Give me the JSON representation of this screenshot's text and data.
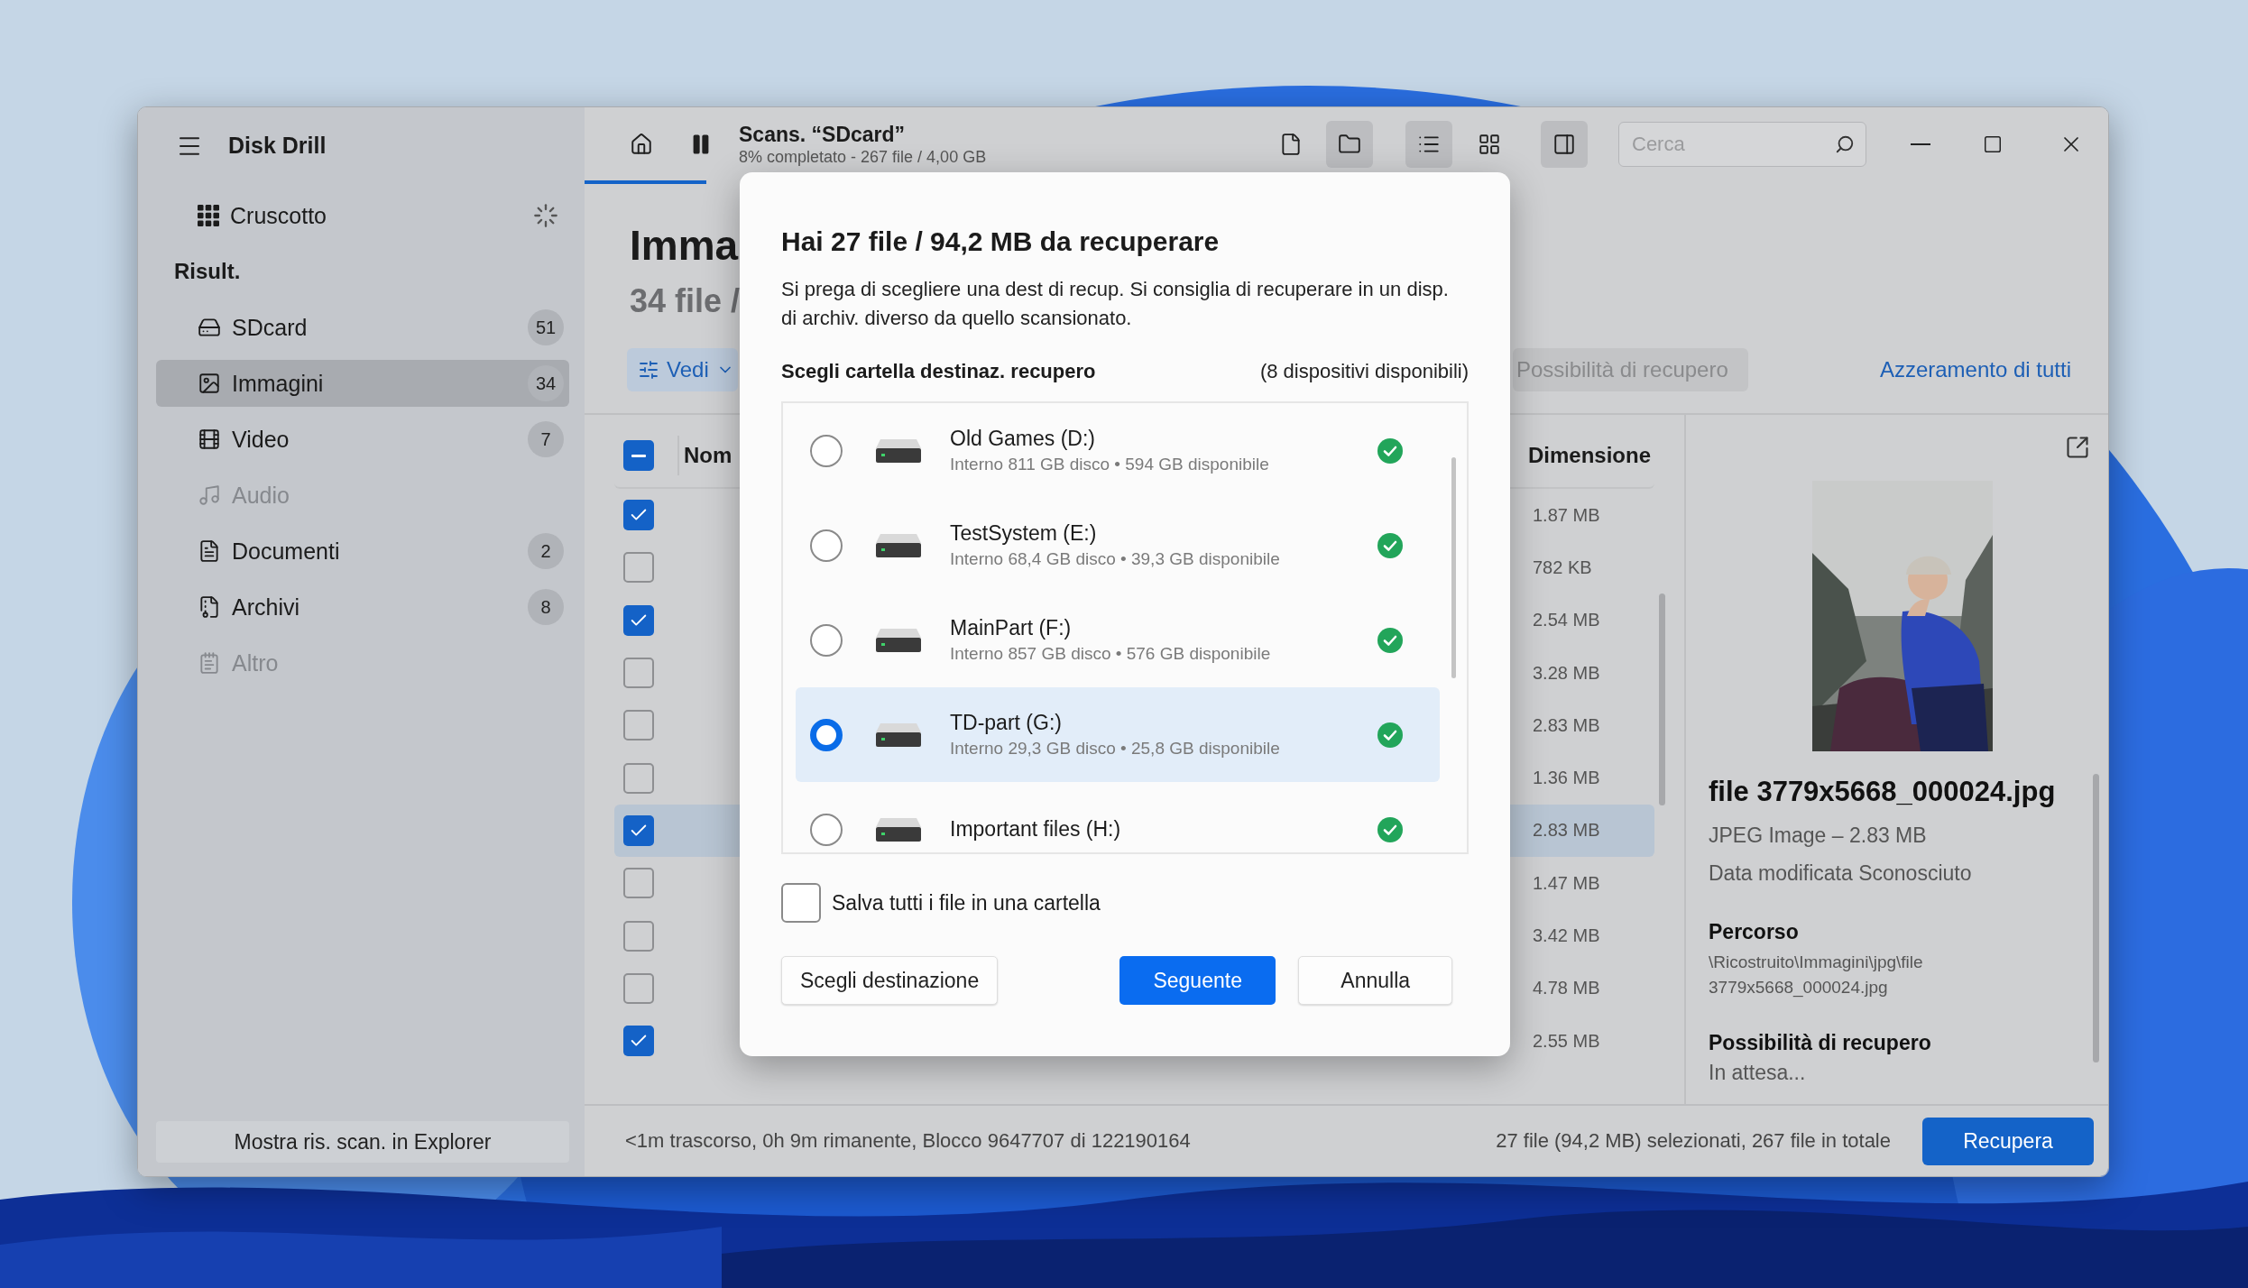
{
  "app": {
    "title": "Disk Drill"
  },
  "sidebar": {
    "dashboard": {
      "label": "Cruscotto",
      "busy": true
    },
    "results_heading": "Risult.",
    "categories": [
      {
        "label": "SDcard",
        "count": "51",
        "selected": false,
        "disabled": false
      },
      {
        "label": "Immagini",
        "count": "34",
        "selected": true,
        "disabled": false
      },
      {
        "label": "Video",
        "count": "7",
        "selected": false,
        "disabled": false
      },
      {
        "label": "Audio",
        "selected": false,
        "disabled": true
      },
      {
        "label": "Documenti",
        "count": "2",
        "selected": false,
        "disabled": false
      },
      {
        "label": "Archivi",
        "count": "8",
        "selected": false,
        "disabled": false
      },
      {
        "label": "Altro",
        "selected": false,
        "disabled": true
      }
    ],
    "explorer_button": "Mostra ris. scan. in Explorer"
  },
  "toolbar": {
    "scan_title": "Scans. “SDcard”",
    "scan_progress": "8% completato - 267 file / 4,00 GB",
    "progress": {
      "level": 0.08
    },
    "view_buttons": [
      {
        "kind": "file",
        "selected": false
      },
      {
        "kind": "folder",
        "selected": true
      },
      {
        "kind": "list",
        "selected": true
      },
      {
        "kind": "grid",
        "selected": false
      },
      {
        "kind": "panel",
        "selected": true
      }
    ],
    "search": {
      "placeholder": "Cerca"
    }
  },
  "content": {
    "heading": "Imma",
    "subheading": "34 file /",
    "view_button": "Vedi",
    "filter_chip": "Possibilità di recupero",
    "reset_link": "Azzeramento di tutti"
  },
  "table": {
    "select_all": {
      "indeterminate": true
    },
    "columns": [
      "Nom",
      "Dimensione"
    ],
    "rows": [
      {
        "checked": true,
        "selected": false,
        "size": "1.87 MB"
      },
      {
        "checked": false,
        "selected": false,
        "size": "782 KB"
      },
      {
        "checked": true,
        "selected": false,
        "size": "2.54 MB"
      },
      {
        "checked": false,
        "selected": false,
        "size": "3.28 MB"
      },
      {
        "checked": false,
        "selected": false,
        "size": "2.83 MB"
      },
      {
        "checked": false,
        "selected": false,
        "size": "1.36 MB"
      },
      {
        "checked": true,
        "selected": true,
        "size": "2.83 MB"
      },
      {
        "checked": false,
        "selected": false,
        "size": "1.47 MB"
      },
      {
        "checked": false,
        "selected": false,
        "size": "3.42 MB"
      },
      {
        "checked": false,
        "selected": false,
        "size": "4.78 MB"
      },
      {
        "checked": true,
        "selected": false,
        "size": "2.55 MB"
      }
    ]
  },
  "preview": {
    "kind": "picture",
    "filename": "file 3779x5668_000024.jpg",
    "type_size": "JPEG Image – 2.83 MB",
    "modified": "Data modificata Sconosciuto",
    "path_label": "Percorso",
    "path": "\\Ricostruito\\Immagini\\jpg\\file 3779x5668_000024.jpg",
    "recovery_label": "Possibilità di recupero",
    "recovery_value": "In attesa..."
  },
  "status_bar": {
    "progress_text": "<1m trascorso, 0h 9m rimanente, Blocco 9647707 di 122190164",
    "selection_text": "27 file (94,2 MB) selezionati, 267 file in totale",
    "recover_button": "Recupera"
  },
  "dialog": {
    "title": "Hai 27 file / 94,2 MB da recuperare",
    "description": "Si prega di scegliere una dest di recup. Si consiglia di recuperare in un disp. di archiv. diverso da quello scansionato.",
    "section_label": "Scegli cartella destinaz. recupero",
    "device_count": "(8 dispositivi disponibili)",
    "drives": [
      {
        "name": "Old Games (D:)",
        "detail": "Interno 811 GB disco • 594 GB disponibile",
        "selected": false
      },
      {
        "name": "TestSystem (E:)",
        "detail": "Interno 68,4 GB disco • 39,3 GB disponibile",
        "selected": false
      },
      {
        "name": "MainPart (F:)",
        "detail": "Interno 857 GB disco • 576 GB disponibile",
        "selected": false
      },
      {
        "name": "TD-part (G:)",
        "detail": "Interno 29,3 GB disco • 25,8 GB disponibile",
        "selected": true
      },
      {
        "name": "Important files (H:)",
        "selected": false
      }
    ],
    "save_all": {
      "label": "Salva tutti i file in una cartella",
      "checked": false
    },
    "buttons": [
      {
        "label": "Scegli destinazione",
        "kind": "secondary"
      },
      {
        "label": "Seguente",
        "kind": "primary"
      },
      {
        "label": "Annulla",
        "kind": "secondary"
      }
    ]
  }
}
